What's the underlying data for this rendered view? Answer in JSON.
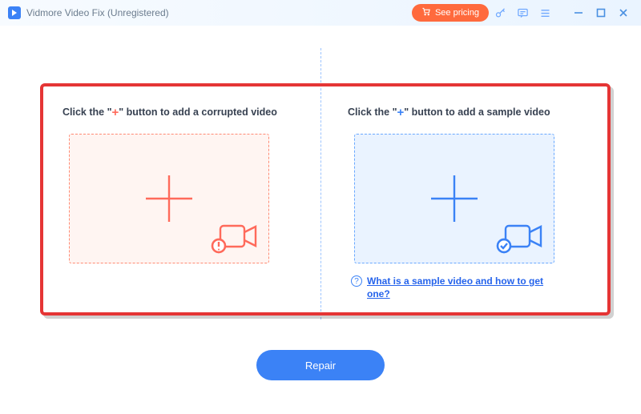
{
  "titlebar": {
    "app_title": "Vidmore Video Fix (Unregistered)",
    "see_pricing_label": "See pricing"
  },
  "panels": {
    "corrupted": {
      "instruction_prefix": "Click the \"",
      "instruction_plus": "+",
      "instruction_suffix": "\" button to add a corrupted video"
    },
    "sample": {
      "instruction_prefix": "Click the \"",
      "instruction_plus": "+",
      "instruction_suffix": "\" button to add a sample video",
      "help_text": "What is a sample video and how to get one?"
    }
  },
  "actions": {
    "repair_label": "Repair"
  }
}
